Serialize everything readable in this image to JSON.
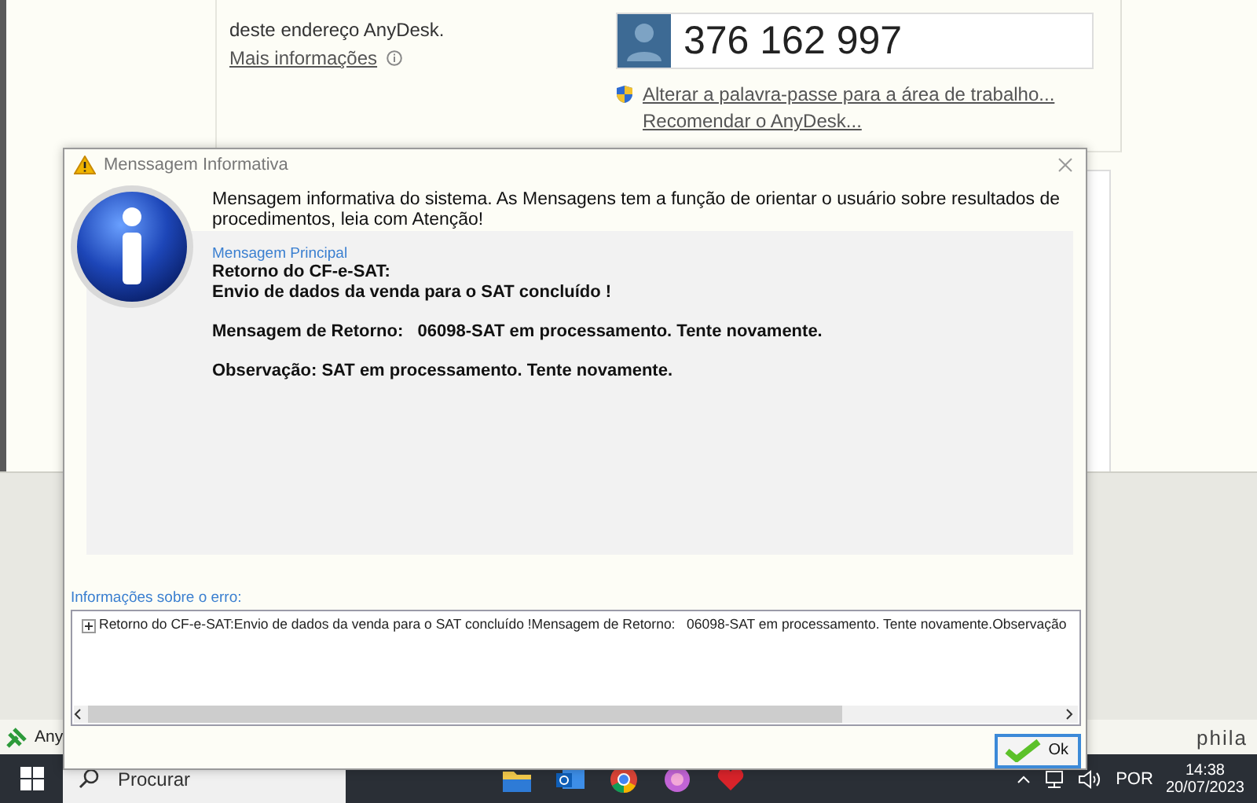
{
  "background_window": {
    "description": "deste endereço AnyDesk.",
    "more_info_link": "Mais informações",
    "address": "376 162 997",
    "links": [
      "Alterar a palavra-passe para a área de trabalho...",
      "Recomendar o AnyDesk..."
    ]
  },
  "dialog": {
    "title": "Menssagem Informativa",
    "intro": "Mensagem informativa do sistema. As Mensagens tem a função de orientar o usuário sobre resultados de procedimentos, leia com Atenção!",
    "main_message_label": "Mensagem Principal",
    "message_paragraphs": [
      [
        "Retorno do CF-e-SAT:",
        "Envio de dados da venda para o SAT concluído !"
      ],
      [
        "Mensagem de Retorno:   06098-SAT em processamento. Tente novamente."
      ],
      [
        "Observação: SAT em processamento. Tente novamente."
      ]
    ],
    "error_info_label": "Informações sobre o erro:",
    "error_tree": [
      {
        "text": "Retorno do CF-e-SAT:Envio de dados da venda para o SAT concluído !Mensagem de Retorno:   06098-SAT em processamento. Tente novamente.Observação",
        "expanded": false
      }
    ],
    "ok_button": "Ok"
  },
  "desktop_strip": {
    "app_label": "Any",
    "brand_text": "phila"
  },
  "taskbar": {
    "search_placeholder": "Procurar",
    "language": "POR",
    "time": "14:38",
    "date": "20/07/2023"
  }
}
